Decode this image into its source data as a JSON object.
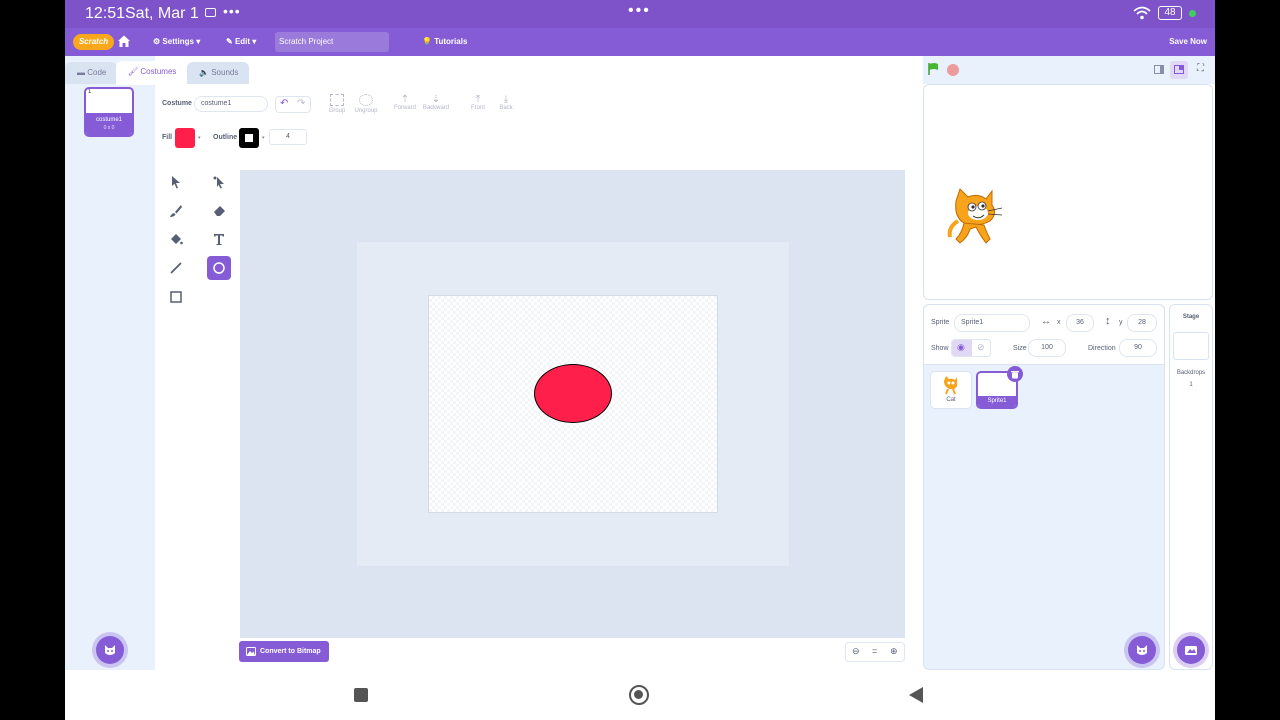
{
  "status_bar": {
    "time": "12:51",
    "date": "Sat, Mar 1",
    "battery": "48"
  },
  "menu": {
    "logo": "Scratch",
    "settings": "Settings",
    "edit": "Edit",
    "project_title": "Scratch Project",
    "tutorials": "Tutorials",
    "save_now": "Save Now"
  },
  "tabs": {
    "code": "Code",
    "costumes": "Costumes",
    "sounds": "Sounds"
  },
  "costume_list": [
    {
      "number": "1",
      "name": "costume1",
      "size": "0 x 0"
    }
  ],
  "paint_toolbar": {
    "costume_label": "Costume",
    "costume_name": "costume1",
    "group": "Group",
    "ungroup": "Ungroup",
    "forward": "Forward",
    "backward": "Backward",
    "front": "Front",
    "back": "Back",
    "fill_label": "Fill",
    "outline_label": "Outline",
    "outline_width": "4",
    "fill_color": "#ff1f4b",
    "outline_color": "#000000"
  },
  "convert_button": "Convert to Bitmap",
  "zoom": {
    "out": "−",
    "reset": "=",
    "in": "+"
  },
  "sprite_info": {
    "sprite_label": "Sprite",
    "sprite_name": "Sprite1",
    "x_label": "x",
    "x_value": "36",
    "y_label": "y",
    "y_value": "28",
    "show_label": "Show",
    "size_label": "Size",
    "size_value": "100",
    "direction_label": "Direction",
    "direction_value": "90"
  },
  "sprites": [
    {
      "name": "Cat"
    },
    {
      "name": "Sprite1",
      "selected": true
    }
  ],
  "stage_pane": {
    "title": "Stage",
    "backdrops_label": "Backdrops",
    "backdrops_count": "1"
  },
  "colors": {
    "accent": "#855cd6",
    "menu": "#855cd6",
    "status": "#7e53c9"
  }
}
